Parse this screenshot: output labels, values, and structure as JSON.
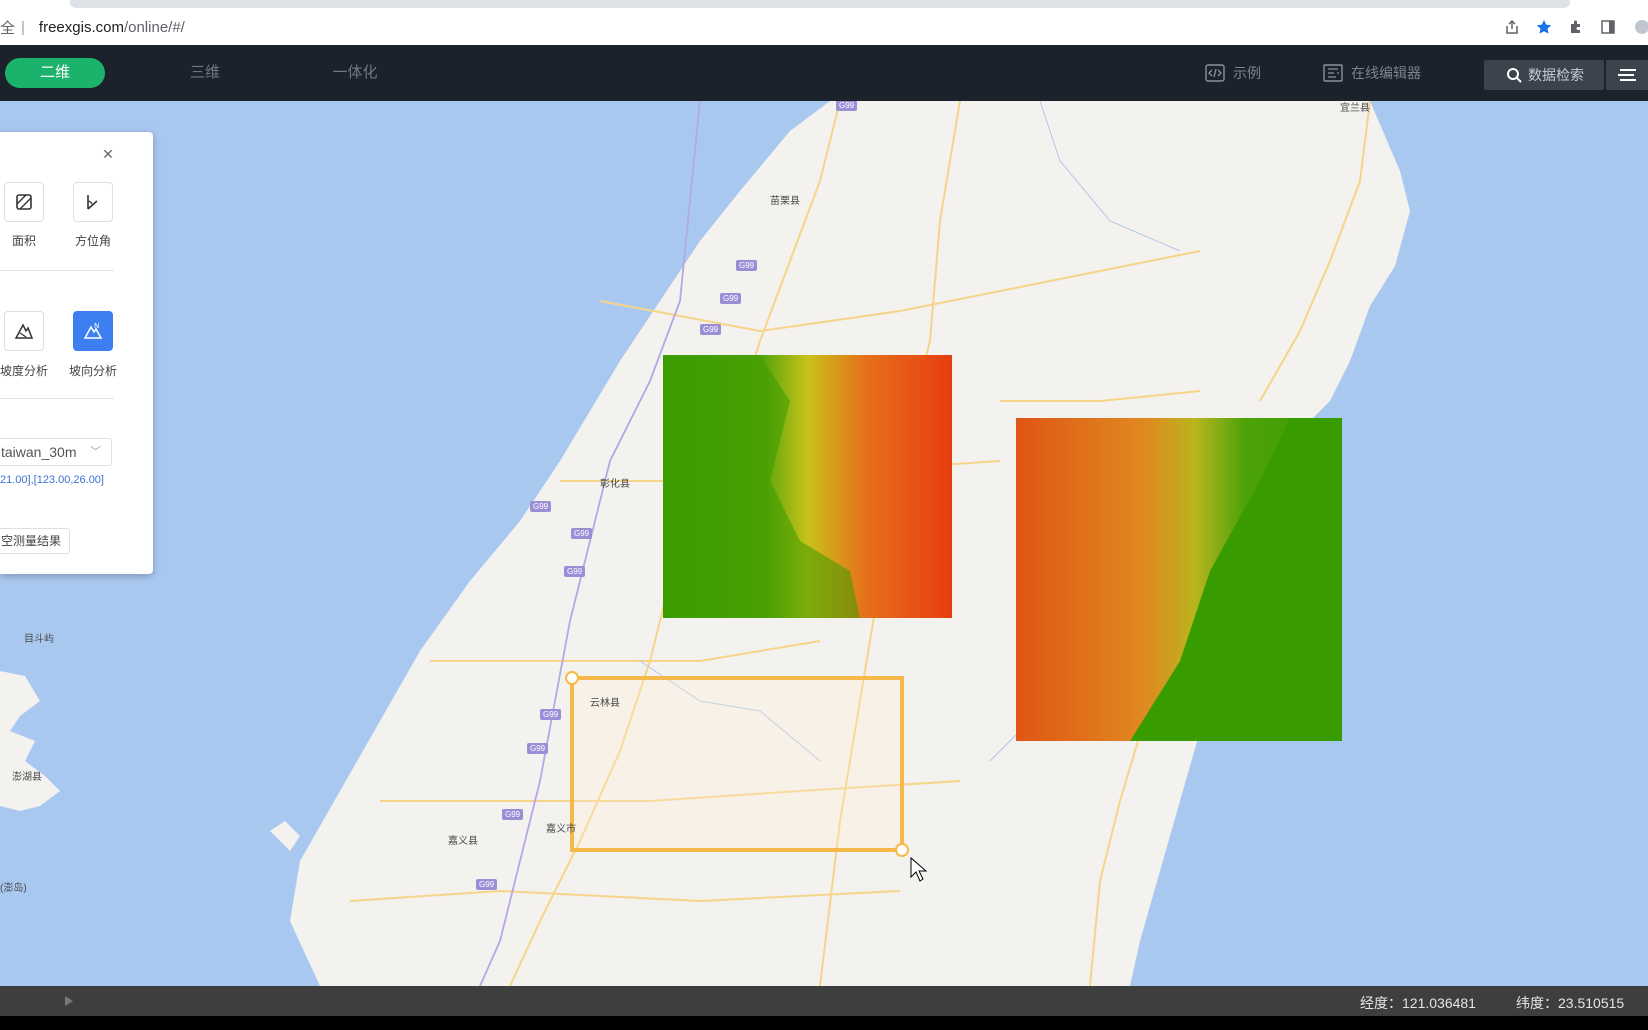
{
  "browser": {
    "url_prefix": "全",
    "url_host": "freexgis.com",
    "url_path": "/online/#/"
  },
  "header": {
    "tabs": [
      {
        "label": "二维",
        "active": true
      },
      {
        "label": "三维",
        "active": false
      },
      {
        "label": "一体化",
        "active": false
      }
    ],
    "example_label": "示例",
    "editor_label": "在线编辑器",
    "search_label": "数据检索"
  },
  "panel": {
    "tools_row1": [
      {
        "label": "面积",
        "icon": "area-measure-icon"
      },
      {
        "label": "方位角",
        "icon": "azimuth-icon"
      }
    ],
    "tools_row2": [
      {
        "label": "坡度分析",
        "icon": "slope-icon",
        "active": false
      },
      {
        "label": "坡向分析",
        "icon": "aspect-icon",
        "active": true
      }
    ],
    "dem_select_value": "taiwan_30m",
    "range_text": "21.00],[123.00,26.00]",
    "clear_button": "空测量结果"
  },
  "map": {
    "places": [
      "宜兰县",
      "苗栗县",
      "彰化县",
      "云林县",
      "嘉义市",
      "嘉义县",
      "澎湖县",
      "目斗屿",
      "(澎岛)"
    ],
    "highways": [
      "G99",
      "G99",
      "G99",
      "G99",
      "G99",
      "G99",
      "G99",
      "G99",
      "G99",
      "G99",
      "G99"
    ]
  },
  "status": {
    "longitude": "经度：121.036481",
    "latitude": "纬度：23.510515"
  }
}
